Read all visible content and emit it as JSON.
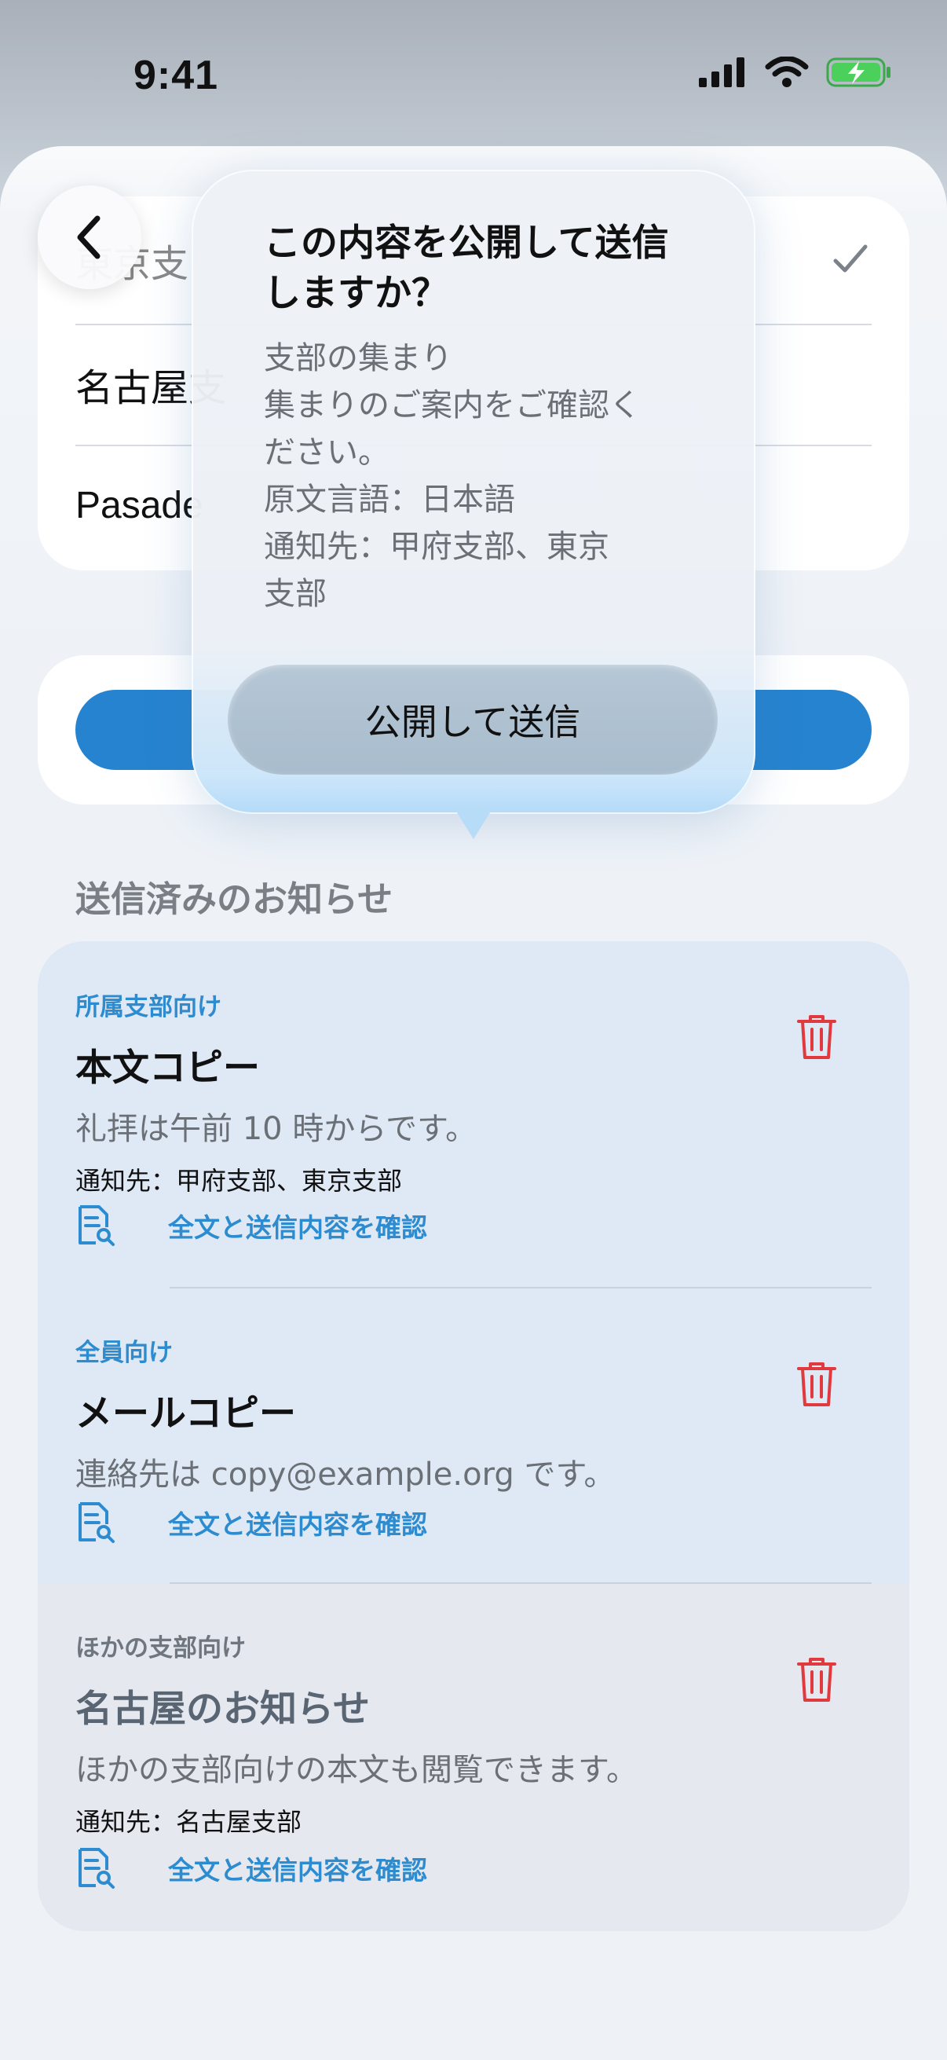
{
  "status_bar": {
    "time": "9:41"
  },
  "branches": {
    "items": [
      {
        "label": "東京支部",
        "visible_label": "東京支",
        "selected": true
      },
      {
        "label": "名古屋支部",
        "visible_label": "名古屋支"
      },
      {
        "label": "Pasadena",
        "visible_label": "Pasade"
      }
    ]
  },
  "popover": {
    "title": "この内容を公開して送信しますか？",
    "body_lines": [
      "支部の集まり",
      "集まりのご案内をご確認く",
      "ださい。",
      "原文言語：日本語",
      "通知先：甲府支部、東京",
      "支部"
    ],
    "confirm_label": "公開して送信"
  },
  "sent": {
    "section_title": "送信済みのお知らせ",
    "notices": [
      {
        "tag": "所属支部向け",
        "title": "本文コピー",
        "body": "礼拝は午前 10 時からです。",
        "destination": "通知先：甲府支部、東京支部",
        "link": "全文と送信内容を確認"
      },
      {
        "tag": "全員向け",
        "title": "メールコピー",
        "body": "連絡先は copy@example.org です。",
        "link": "全文と送信内容を確認"
      },
      {
        "tag": "ほかの支部向け",
        "title": "名古屋のお知らせ",
        "body": "ほかの支部向けの本文も閲覧できます。",
        "destination": "通知先：名古屋支部",
        "link": "全文と送信内容を確認"
      }
    ]
  },
  "colors": {
    "accent": "#2683cf",
    "link": "#2d8bd0",
    "delete": "#e0393e",
    "muted_tag": "#707680"
  },
  "icons": [
    "chevron-left-icon",
    "checkmark-icon",
    "signal-icon",
    "wifi-icon",
    "battery-charging-icon",
    "document-search-icon",
    "trash-icon"
  ]
}
